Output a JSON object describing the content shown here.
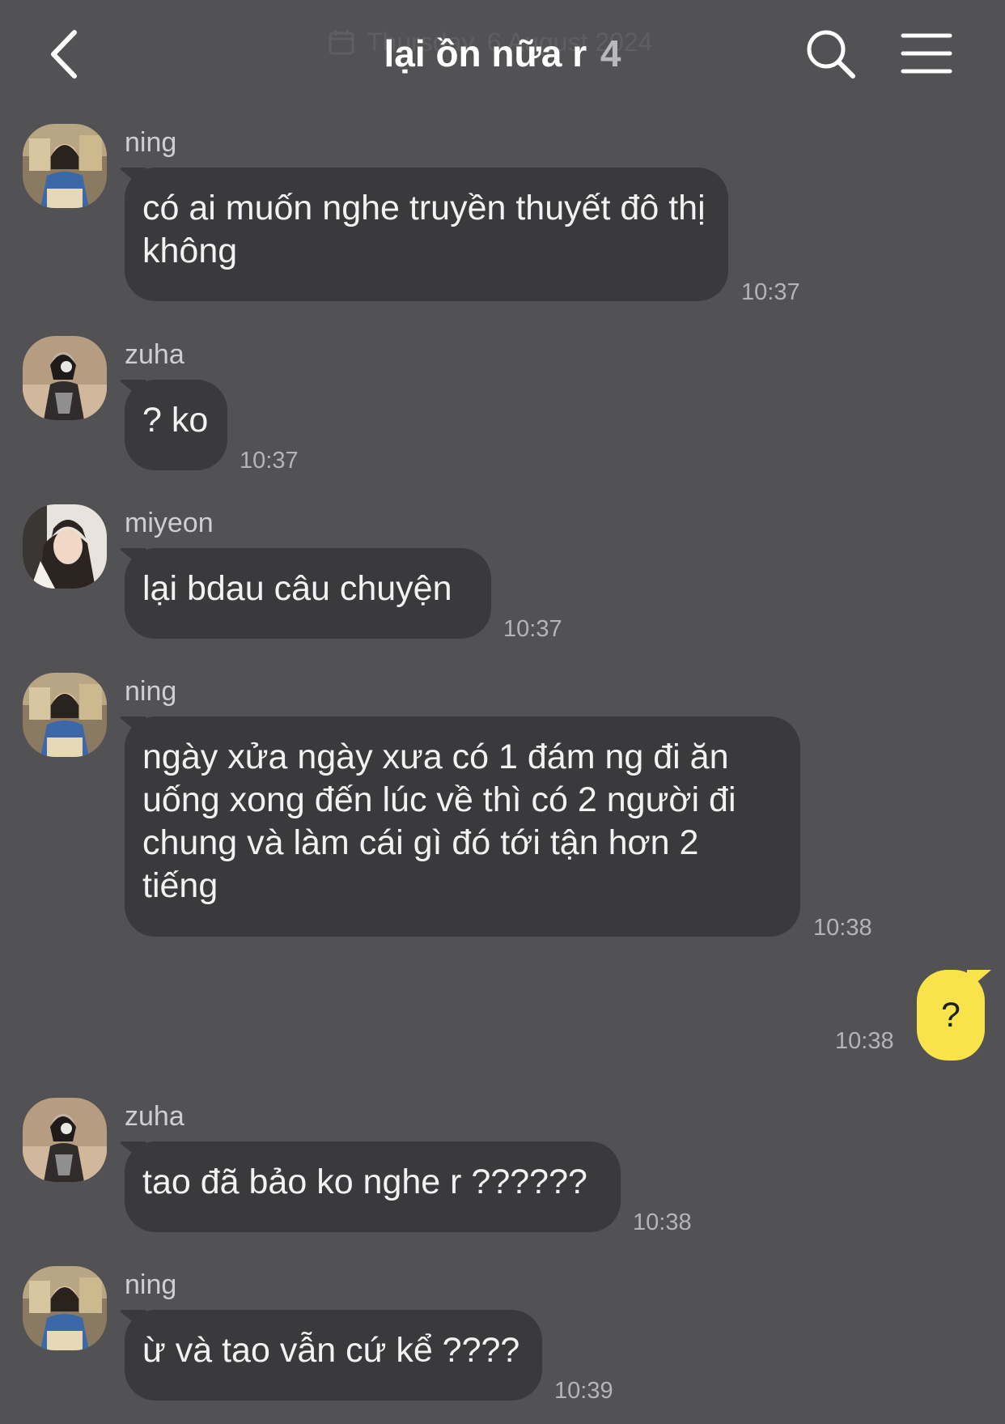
{
  "header": {
    "title": "lại ồn nữa r",
    "member_count": "4",
    "date_banner": "Thursday, 6 August 2024",
    "back_icon": "chevron-left-icon",
    "search_icon": "search-icon",
    "menu_icon": "hamburger-menu-icon"
  },
  "messages": [
    {
      "sender": "ning",
      "text": "có ai muốn nghe truyền thuyết đô thị không",
      "time": "10:37"
    },
    {
      "sender": "zuha",
      "text": "? ko",
      "time": "10:37"
    },
    {
      "sender": "miyeon",
      "text": "lại bdau câu chuyện",
      "time": "10:37"
    },
    {
      "sender": "ning",
      "text": "ngày xửa ngày xưa có 1 đám ng đi ăn uống xong đến lúc về thì có 2 người đi chung và làm cái gì đó tới tận hơn 2 tiếng",
      "time": "10:38"
    },
    {
      "sender": "me",
      "text": "?",
      "time": "10:38"
    },
    {
      "sender": "zuha",
      "text": "tao đã bảo ko nghe r ??????",
      "time": "10:38"
    },
    {
      "sender": "ning",
      "text": "ừ và tao vẫn cứ kể ????",
      "time": "10:39"
    }
  ],
  "colors": {
    "background": "#525154",
    "bubble_other": "#3a393c",
    "bubble_me": "#f8e34a",
    "text_primary": "#f2f2f2",
    "text_secondary": "#b4b3b6"
  }
}
